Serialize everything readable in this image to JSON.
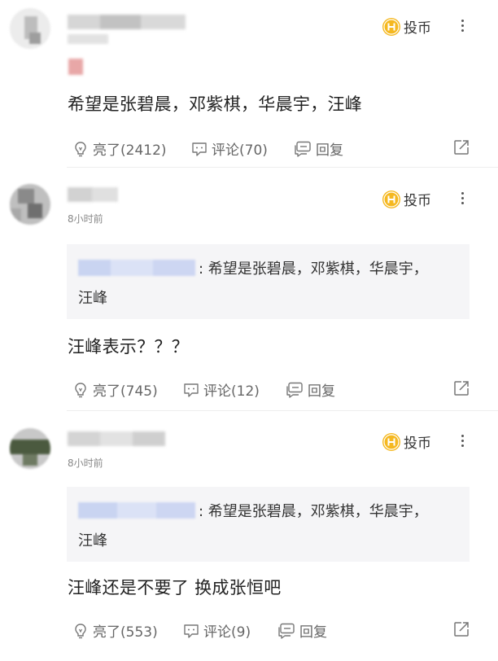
{
  "common": {
    "coin_label": "投币",
    "reply_label": "回复",
    "accent_coin": "#f5b820"
  },
  "comments": [
    {
      "time": "",
      "text": "希望是张碧晨，邓紫棋，华晨宇，汪峰",
      "likes_label": "亮了(2412)",
      "comments_label": "评论(70)",
      "reply_label": "回复"
    },
    {
      "time": "8小时前",
      "quote_text": ": 希望是张碧晨，邓紫棋，华晨宇，",
      "quote_text_line2": "汪峰",
      "text": "汪峰表示？？？",
      "likes_label": "亮了(745)",
      "comments_label": "评论(12)",
      "reply_label": "回复"
    },
    {
      "time": "8小时前",
      "quote_text": ": 希望是张碧晨，邓紫棋，华晨宇，",
      "quote_text_line2": "汪峰",
      "text": "汪峰还是不要了 换成张恒吧",
      "likes_label": "亮了(553)",
      "comments_label": "评论(9)",
      "reply_label": "回复"
    }
  ]
}
